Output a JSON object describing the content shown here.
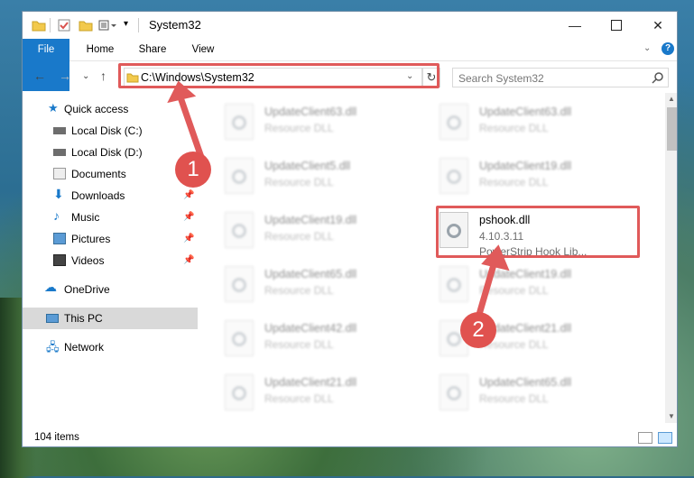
{
  "window": {
    "title": "System32",
    "controls": [
      "minimize-icon",
      "maximize-icon",
      "close-icon"
    ]
  },
  "ribbon": {
    "tabs": [
      "File",
      "Home",
      "Share",
      "View"
    ],
    "help": "?"
  },
  "navigation": {
    "address": "C:\\Windows\\System32",
    "search_placeholder": "Search System32"
  },
  "sidebar": {
    "items": [
      {
        "label": "Quick access",
        "icon": "star-icon"
      },
      {
        "label": "Local Disk (C:)",
        "icon": "drive-icon"
      },
      {
        "label": "Local Disk (D:)",
        "icon": "drive-icon"
      },
      {
        "label": "Documents",
        "icon": "documents-icon"
      },
      {
        "label": "Downloads",
        "icon": "download-icon"
      },
      {
        "label": "Music",
        "icon": "music-icon"
      },
      {
        "label": "Pictures",
        "icon": "pictures-icon"
      },
      {
        "label": "Videos",
        "icon": "videos-icon"
      },
      {
        "label": "OneDrive",
        "icon": "cloud-icon"
      },
      {
        "label": "This PC",
        "icon": "computer-icon"
      },
      {
        "label": "Network",
        "icon": "network-icon"
      }
    ]
  },
  "files": [
    {
      "name": "UpdateClient63.dll",
      "type": "Resource DLL"
    },
    {
      "name": "UpdateClient63.dll",
      "type": "Resource DLL"
    },
    {
      "name": "UpdateClient5.dll",
      "type": "Resource DLL"
    },
    {
      "name": "UpdateClient19.dll",
      "type": "Resource DLL"
    },
    {
      "name": "UpdateClient19.dll",
      "type": "Resource DLL"
    },
    {
      "name": "pshook.dll",
      "version": "4.10.3.11",
      "description": "PowerStrip Hook Lib..."
    },
    {
      "name": "UpdateClient65.dll",
      "type": "Resource DLL"
    },
    {
      "name": "UpdateClient19.dll",
      "type": "Resource DLL"
    },
    {
      "name": "UpdateClient42.dll",
      "type": "Resource DLL"
    },
    {
      "name": "UpdateClient21.dll",
      "type": "Resource DLL"
    },
    {
      "name": "UpdateClient21.dll",
      "type": "Resource DLL"
    },
    {
      "name": "UpdateClient65.dll",
      "type": "Resource DLL"
    }
  ],
  "status": {
    "count": "104 items"
  },
  "annotations": {
    "step1": "1",
    "step2": "2",
    "color": "#e05a5a"
  }
}
